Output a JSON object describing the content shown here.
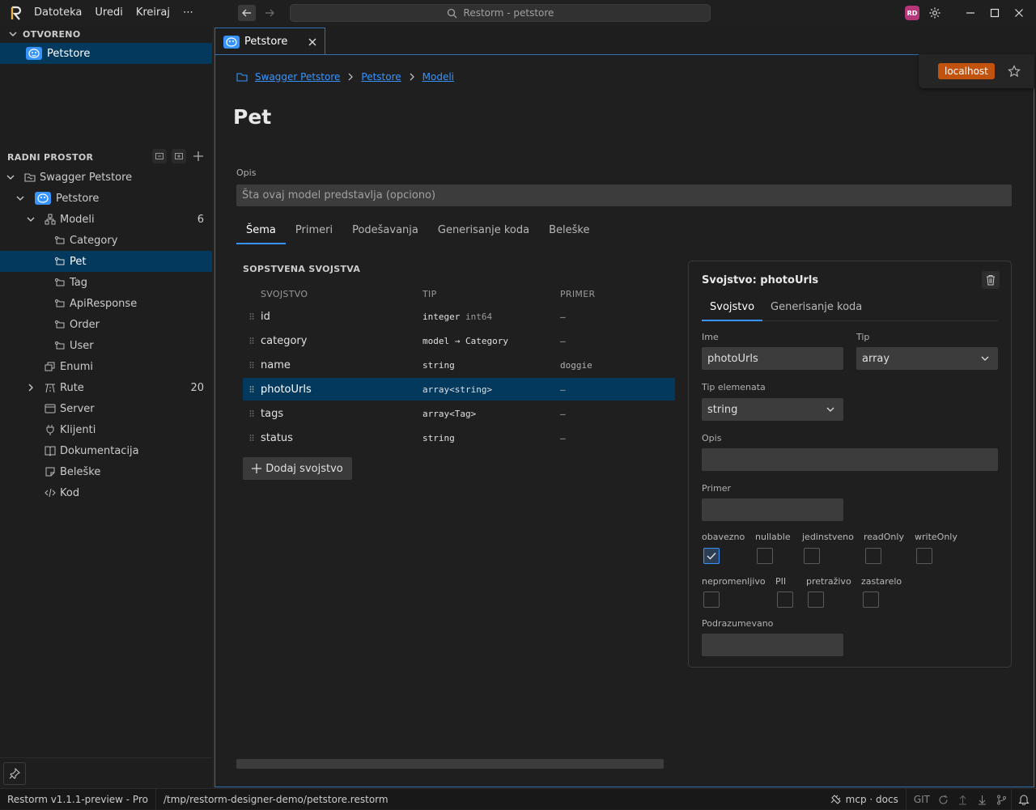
{
  "menu": {
    "file": "Datoteka",
    "edit": "Uredi",
    "create": "Kreiraj",
    "more": "⋯"
  },
  "search": {
    "text": "Restorm - petstore"
  },
  "user": {
    "initials": "RD"
  },
  "sidebar": {
    "open_title": "OTVORENO",
    "open_item": "Petstore",
    "workspace_title": "RADNI PROSTOR",
    "tree": {
      "root": "Swagger Petstore",
      "api": "Petstore",
      "models": {
        "label": "Modeli",
        "count": "6"
      },
      "model_items": [
        "Category",
        "Pet",
        "Tag",
        "ApiResponse",
        "Order",
        "User"
      ],
      "enums": "Enumi",
      "routes": {
        "label": "Rute",
        "count": "20"
      },
      "server": "Server",
      "clients": "Klijenti",
      "docs": "Dokumentacija",
      "notes": "Beleške",
      "code": "Kod"
    }
  },
  "tab": {
    "label": "Petstore"
  },
  "env": {
    "label": "localhost"
  },
  "breadcrumb": [
    "Swagger Petstore",
    "Petstore",
    "Modeli"
  ],
  "page": {
    "title": "Pet",
    "desc_label": "Opis",
    "desc_placeholder": "Šta ovaj model predstavlja (opciono)",
    "tabs": [
      "Šema",
      "Primeri",
      "Podešavanja",
      "Generisanje koda",
      "Beleške"
    ]
  },
  "props": {
    "title": "SOPSTVENA SVOJSTVA",
    "headers": {
      "name": "SVOJSTVO",
      "type": "TIP",
      "example": "PRIMER"
    },
    "rows": [
      {
        "name": "id",
        "type": "integer",
        "fmt": "int64",
        "example": "–"
      },
      {
        "name": "category",
        "type": "model → Category",
        "fmt": "",
        "example": "–"
      },
      {
        "name": "name",
        "type": "string",
        "fmt": "",
        "example": "doggie"
      },
      {
        "name": "photoUrls",
        "type": "array<string>",
        "fmt": "",
        "example": "–"
      },
      {
        "name": "tags",
        "type": "array<Tag>",
        "fmt": "",
        "example": "–"
      },
      {
        "name": "status",
        "type": "string",
        "fmt": "",
        "example": "–"
      }
    ],
    "add_label": "Dodaj svojstvo"
  },
  "panel": {
    "title": "Svojstvo: photoUrls",
    "tabs": [
      "Svojstvo",
      "Generisanje koda"
    ],
    "name_label": "Ime",
    "name_value": "photoUrls",
    "type_label": "Tip",
    "type_value": "array",
    "items_label": "Tip elemenata",
    "items_value": "string",
    "desc_label": "Opis",
    "example_label": "Primer",
    "flags": [
      {
        "label": "obavezno",
        "checked": true
      },
      {
        "label": "nullable",
        "checked": false
      },
      {
        "label": "jedinstveno",
        "checked": false
      },
      {
        "label": "readOnly",
        "checked": false
      },
      {
        "label": "writeOnly",
        "checked": false
      },
      {
        "label": "nepromenljivo",
        "checked": false
      },
      {
        "label": "PII",
        "checked": false
      },
      {
        "label": "pretraživo",
        "checked": false
      },
      {
        "label": "zastarelo",
        "checked": false
      }
    ],
    "default_label": "Podrazumevano"
  },
  "status": {
    "version": "Restorm v1.1.1-preview - Pro",
    "path": "/tmp/restorm-designer-demo/petstore.restorm",
    "mcp": "mcp · docs",
    "git": "GIT"
  },
  "colors": {
    "accent": "#3794ff",
    "selection": "#04395e",
    "env": "#c2530e",
    "avatar": "#b5377a"
  }
}
